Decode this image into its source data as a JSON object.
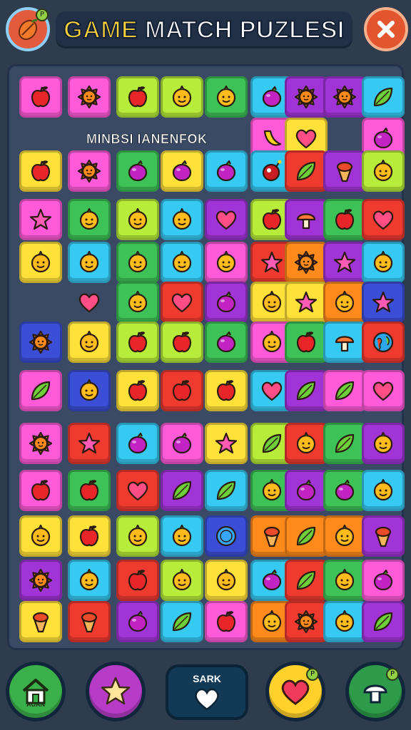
{
  "title": {
    "part1": "GAME",
    "part2": "MATCH PUZLESI"
  },
  "header": {
    "logo_badge": "P"
  },
  "board": {
    "label": "MINBSI IANENFOK"
  },
  "bottom": {
    "pill_label": "SARK",
    "home_label": "AUAN",
    "heart_badge": "P",
    "mushroom_badge": "P"
  },
  "colors": {
    "background": "#2f3c4e",
    "board": "#3a4a64",
    "title_accent": "#ffd23a",
    "close": "#e2552f"
  },
  "tiles": [
    [
      "magenta",
      "apple"
    ],
    [
      "magenta",
      "sun"
    ],
    [
      "lime",
      "apple"
    ],
    [
      "lime",
      "face"
    ],
    [
      "green",
      "face"
    ],
    [
      "cyan",
      "berry"
    ],
    [
      "purple",
      "sun"
    ],
    [
      "purple",
      "sun"
    ],
    [
      "cyan",
      "leaf"
    ],
    [
      "magenta",
      "banana"
    ],
    [
      "yellow",
      "heart"
    ],
    [
      "magenta",
      "berry"
    ],
    [
      "yellow",
      "apple"
    ],
    [
      "magenta",
      "sun"
    ],
    [
      "green",
      "berry"
    ],
    [
      "yellow",
      "berry"
    ],
    [
      "cyan",
      "berry"
    ],
    [
      "cyan",
      "bomb"
    ],
    [
      "red",
      "leaf"
    ],
    [
      "purple",
      "cone"
    ],
    [
      "lime",
      "face"
    ],
    [
      "magenta",
      "star"
    ],
    [
      "green",
      "face"
    ],
    [
      "lime",
      "face"
    ],
    [
      "cyan",
      "face"
    ],
    [
      "purple",
      "heart"
    ],
    [
      "lime",
      "apple"
    ],
    [
      "purple",
      "mushroom"
    ],
    [
      "green",
      "apple"
    ],
    [
      "red",
      "heart"
    ],
    [
      "yellow",
      "face"
    ],
    [
      "cyan",
      "face"
    ],
    [
      "green",
      "face"
    ],
    [
      "cyan",
      "face"
    ],
    [
      "magenta",
      "face"
    ],
    [
      "red",
      "star"
    ],
    [
      "orange",
      "sun"
    ],
    [
      "purple",
      "star"
    ],
    [
      "cyan",
      "face"
    ],
    [
      "none",
      "heart"
    ],
    [
      "green",
      "face"
    ],
    [
      "red",
      "heart"
    ],
    [
      "purple",
      "berry"
    ],
    [
      "yellow",
      "face"
    ],
    [
      "yellow",
      "star"
    ],
    [
      "orange",
      "face"
    ],
    [
      "blue",
      "star"
    ],
    [
      "blue",
      "sun"
    ],
    [
      "yellow",
      "face"
    ],
    [
      "lime",
      "apple"
    ],
    [
      "lime",
      "apple"
    ],
    [
      "green",
      "berry"
    ],
    [
      "magenta",
      "face"
    ],
    [
      "green",
      "apple"
    ],
    [
      "cyan",
      "mushroom"
    ],
    [
      "red",
      "globe"
    ],
    [
      "magenta",
      "leaf"
    ],
    [
      "blue",
      "face"
    ],
    [
      "yellow",
      "apple"
    ],
    [
      "red",
      "apple"
    ],
    [
      "yellow",
      "apple"
    ],
    [
      "cyan",
      "heart"
    ],
    [
      "purple",
      "leaf"
    ],
    [
      "magenta",
      "leaf"
    ],
    [
      "magenta",
      "heart"
    ],
    [
      "magenta",
      "sun"
    ],
    [
      "red",
      "star"
    ],
    [
      "cyan",
      "berry"
    ],
    [
      "magenta",
      "berry"
    ],
    [
      "yellow",
      "star"
    ],
    [
      "lime",
      "leaf"
    ],
    [
      "red",
      "face"
    ],
    [
      "green",
      "leaf"
    ],
    [
      "purple",
      "face"
    ],
    [
      "magenta",
      "apple"
    ],
    [
      "green",
      "apple"
    ],
    [
      "red",
      "heart"
    ],
    [
      "purple",
      "leaf"
    ],
    [
      "cyan",
      "leaf"
    ],
    [
      "green",
      "face"
    ],
    [
      "purple",
      "berry"
    ],
    [
      "green",
      "berry"
    ],
    [
      "cyan",
      "face"
    ],
    [
      "yellow",
      "face"
    ],
    [
      "yellow",
      "apple"
    ],
    [
      "lime",
      "face"
    ],
    [
      "cyan",
      "face"
    ],
    [
      "blue",
      "coin"
    ],
    [
      "orange",
      "cone"
    ],
    [
      "orange",
      "leaf"
    ],
    [
      "orange",
      "face"
    ],
    [
      "purple",
      "cone"
    ],
    [
      "purple",
      "sun"
    ],
    [
      "cyan",
      "face"
    ],
    [
      "red",
      "apple"
    ],
    [
      "lime",
      "face"
    ],
    [
      "yellow",
      "face"
    ],
    [
      "cyan",
      "berry"
    ],
    [
      "red",
      "leaf"
    ],
    [
      "green",
      "face"
    ],
    [
      "magenta",
      "berry"
    ],
    [
      "yellow",
      "cone"
    ],
    [
      "red",
      "cone"
    ],
    [
      "purple",
      "berry"
    ],
    [
      "cyan",
      "leaf"
    ],
    [
      "magenta",
      "apple"
    ],
    [
      "orange",
      "face"
    ],
    [
      "red",
      "sun"
    ],
    [
      "cyan",
      "face"
    ],
    [
      "purple",
      "leaf"
    ]
  ]
}
